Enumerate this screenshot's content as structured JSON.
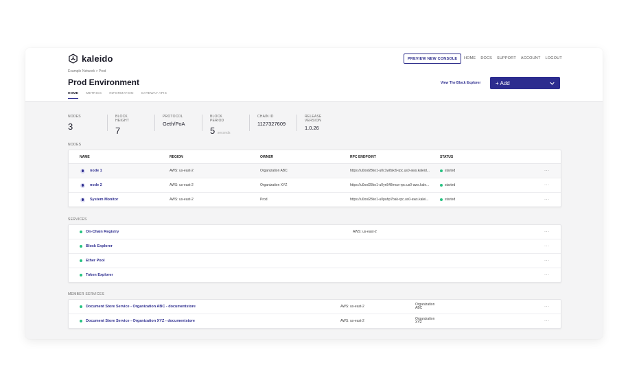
{
  "app": {
    "brand": "kaleido"
  },
  "topbar": {
    "preview_button": "PREVIEW NEW CONSOLE",
    "nav": [
      "HOME",
      "DOCS",
      "SUPPORT",
      "ACCOUNT",
      "LOGOUT"
    ]
  },
  "breadcrumb": "Example Network  >  Prod",
  "page": {
    "title": "Prod Environment",
    "tabs": [
      "HOME",
      "METRICS",
      "INFORMATION",
      "GATEWAY APIS"
    ],
    "active_tab": "HOME",
    "explorer_link": "View The Block Explorer",
    "add_button": "+ Add"
  },
  "stats": [
    {
      "label": "NODES",
      "value": "3"
    },
    {
      "label": "BLOCK HEIGHT",
      "value": "7"
    },
    {
      "label": "PROTOCOL",
      "value": "Geth/PoA"
    },
    {
      "label": "BLOCK PERIOD",
      "value": "5",
      "unit": "seconds"
    },
    {
      "label": "CHAIN ID",
      "value": "1127327609"
    },
    {
      "label": "RELEASE VERSION",
      "value": "1.0.26"
    }
  ],
  "nodes": {
    "section_label": "NODES",
    "headers": [
      "NAME",
      "REGION",
      "OWNER",
      "RPC ENDPOINT",
      "STATUS"
    ],
    "rows": [
      {
        "name": "node 1",
        "region": "AWS: us-east-2",
        "owner": "Organization ABC",
        "rpc": "https://u0ool28ko1-u0c1w8ski9-rpc.us0-aws.kaleid...",
        "status": "started",
        "more": "···"
      },
      {
        "name": "node 2",
        "region": "AWS: us-east-2",
        "owner": "Organization XYZ",
        "rpc": "https://u0ool28ko1-u0yn548mcw-rpc.us0-aws.kale...",
        "status": "started",
        "more": "···"
      },
      {
        "name": "System Monitor",
        "region": "AWS: us-east-2",
        "owner": "Prod",
        "rpc": "https://u0ool28ko1-u0puhp7bak-rpc.us0-aws.kalei...",
        "status": "started",
        "more": "···"
      }
    ]
  },
  "services": {
    "section_label": "SERVICES",
    "rows": [
      {
        "name": "On-Chain Registry",
        "region": "AWS: us-east-2",
        "more": "···"
      },
      {
        "name": "Block Explorer",
        "region": "",
        "more": "···"
      },
      {
        "name": "Ether Pool",
        "region": "",
        "more": "···"
      },
      {
        "name": "Token Explorer",
        "region": "",
        "more": "···"
      }
    ]
  },
  "member_services": {
    "section_label": "MEMBER SERVICES",
    "rows": [
      {
        "name": "Document Store Service - Organization ABC - documentstore",
        "region": "AWS: us-east-2",
        "owner_line1": "Organization",
        "owner_line2": "ABC",
        "more": "···"
      },
      {
        "name": "Document Store Service - Organization XYZ - documentstore",
        "region": "AWS: us-east-2",
        "owner_line1": "Organization",
        "owner_line2": "XYZ",
        "more": "···"
      }
    ]
  },
  "colors": {
    "accent": "#2c2c8f",
    "status_green": "#26c281",
    "background": "#f4f4f5"
  },
  "icons": {
    "logo": "kaleido-logo-icon",
    "status": "status-dot-icon",
    "node": "node-indicator-icon",
    "more": "more-icon",
    "add_menu": "chevron-down-icon"
  }
}
